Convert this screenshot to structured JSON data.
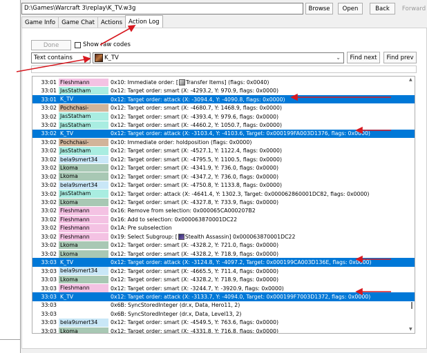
{
  "toolbar": {
    "path": "D:\\Games\\Warcraft 3\\replay\\K_TV.w3g",
    "browse_label": "Browse",
    "open_label": "Open",
    "back_label": "Back",
    "forward_label": "Forward"
  },
  "tabs": [
    {
      "label": "Game Info"
    },
    {
      "label": "Game Chat"
    },
    {
      "label": "Actions"
    },
    {
      "label": "Action Log"
    }
  ],
  "filter": {
    "done_label": "Done",
    "show_raw_label": "Show raw codes",
    "filter_type": "Text contains",
    "search_value": "K_TV",
    "find_next_label": "Find next",
    "find_prev_label": "Find prev"
  },
  "colors": {
    "Fleshmann": "#f4c2e3",
    "JasStatham": "#a9ede1",
    "K_TV": "#a9dbc8",
    "Pochchasi-": "#d2b49a",
    "bela9smert34": "#c9e7f7",
    "Lkoma": "#a8c8b4",
    "selected": "#0078d7",
    "arrow": "#d71920"
  },
  "log": [
    {
      "time": "33:01",
      "player": "Fleshmann",
      "pre": "0x10: Immediate order: [",
      "icon": "transfer",
      "post": "Transfer Items] (flags: 0x0040)",
      "selected": false
    },
    {
      "time": "33:01",
      "player": "JasStatham",
      "pre": "0x12: Target order: smart (X: -4293.2, Y: 970.9, flags: 0x0000)",
      "icon": "",
      "post": "",
      "selected": false
    },
    {
      "time": "33:01",
      "player": "K_TV",
      "pre": "0x12: Target order: attack (X: -3094.4, Y: -4090.8, flags: 0x0000)",
      "icon": "",
      "post": "",
      "selected": true
    },
    {
      "time": "33:02",
      "player": "Pochchasi-",
      "pre": "0x12: Target order: smart (X: -4680.7, Y: 1468.9, flags: 0x0000)",
      "icon": "",
      "post": "",
      "selected": false
    },
    {
      "time": "33:02",
      "player": "JasStatham",
      "pre": "0x12: Target order: smart (X: -4393.4, Y: 979.6, flags: 0x0000)",
      "icon": "",
      "post": "",
      "selected": false
    },
    {
      "time": "33:02",
      "player": "JasStatham",
      "pre": "0x12: Target order: smart (X: -4460.2, Y: 1050.7, flags: 0x0000)",
      "icon": "",
      "post": "",
      "selected": false
    },
    {
      "time": "33:02",
      "player": "K_TV",
      "pre": "0x12: Target order: attack (X: -3103.4, Y: -4103.6, Target: 0x000199FA003D1376, flags: 0x0000)",
      "icon": "",
      "post": "",
      "selected": true
    },
    {
      "time": "33:02",
      "player": "Pochchasi-",
      "pre": "0x10: Immediate order: holdposition (flags: 0x0000)",
      "icon": "",
      "post": "",
      "selected": false
    },
    {
      "time": "33:02",
      "player": "JasStatham",
      "pre": "0x12: Target order: smart (X: -4527.1, Y: 1122.4, flags: 0x0000)",
      "icon": "",
      "post": "",
      "selected": false
    },
    {
      "time": "33:02",
      "player": "bela9smert34",
      "pre": "0x12: Target order: smart (X: -4795.5, Y: 1100.5, flags: 0x0000)",
      "icon": "",
      "post": "",
      "selected": false
    },
    {
      "time": "33:02",
      "player": "Lkoma",
      "pre": "0x12: Target order: smart (X: -4341.9, Y: 736.0, flags: 0x0000)",
      "icon": "",
      "post": "",
      "selected": false
    },
    {
      "time": "33:02",
      "player": "Lkoma",
      "pre": "0x12: Target order: smart (X: -4347.2, Y: 736.0, flags: 0x0000)",
      "icon": "",
      "post": "",
      "selected": false
    },
    {
      "time": "33:02",
      "player": "bela9smert34",
      "pre": "0x12: Target order: smart (X: -4750.8, Y: 1133.8, flags: 0x0000)",
      "icon": "",
      "post": "",
      "selected": false
    },
    {
      "time": "33:02",
      "player": "JasStatham",
      "pre": "0x12: Target order: attack (X: -4641.4, Y: 1302.3, Target: 0x000062860001DC82, flags: 0x0000)",
      "icon": "",
      "post": "",
      "selected": false
    },
    {
      "time": "33:02",
      "player": "Lkoma",
      "pre": "0x12: Target order: smart (X: -4327.8, Y: 733.9, flags: 0x0000)",
      "icon": "",
      "post": "",
      "selected": false
    },
    {
      "time": "33:02",
      "player": "Fleshmann",
      "pre": "0x16: Remove from selection: 0x000065CA000207B2",
      "icon": "",
      "post": "",
      "selected": false
    },
    {
      "time": "33:02",
      "player": "Fleshmann",
      "pre": "0x16: Add to selection: 0x000063870001DC22",
      "icon": "",
      "post": "",
      "selected": false
    },
    {
      "time": "33:02",
      "player": "Fleshmann",
      "pre": "0x1A: Pre subselection",
      "icon": "",
      "post": "",
      "selected": false
    },
    {
      "time": "33:02",
      "player": "Fleshmann",
      "pre": "0x19: Select Subgroup: [",
      "icon": "stealth",
      "post": "Stealth Assassin] 0x000063870001DC22",
      "selected": false
    },
    {
      "time": "33:02",
      "player": "Lkoma",
      "pre": "0x12: Target order: smart (X: -4328.2, Y: 721.0, flags: 0x0000)",
      "icon": "",
      "post": "",
      "selected": false
    },
    {
      "time": "33:02",
      "player": "Lkoma",
      "pre": "0x12: Target order: smart (X: -4328.2, Y: 718.9, flags: 0x0000)",
      "icon": "",
      "post": "",
      "selected": false
    },
    {
      "time": "33:03",
      "player": "K_TV",
      "pre": "0x12: Target order: attack (X: -3124.8, Y: -4097.2, Target: 0x000199CA003D136E, flags: 0x0000)",
      "icon": "",
      "post": "",
      "selected": true
    },
    {
      "time": "33:03",
      "player": "bela9smert34",
      "pre": "0x12: Target order: smart (X: -4665.5, Y: 711.4, flags: 0x0000)",
      "icon": "",
      "post": "",
      "selected": false
    },
    {
      "time": "33:03",
      "player": "Lkoma",
      "pre": "0x12: Target order: smart (X: -4328.2, Y: 718.9, flags: 0x0000)",
      "icon": "",
      "post": "",
      "selected": false
    },
    {
      "time": "33:03",
      "player": "Fleshmann",
      "pre": "0x12: Target order: smart (X: -3244.7, Y: -3920.9, flags: 0x0000)",
      "icon": "",
      "post": "",
      "selected": false
    },
    {
      "time": "33:03",
      "player": "K_TV",
      "pre": "0x12: Target order: attack (X: -3133.7, Y: -4094.0, Target: 0x000199F7003D1372, flags: 0x0000)",
      "icon": "",
      "post": "",
      "selected": true
    },
    {
      "time": "33:03",
      "player": "",
      "pre": "0x6B: SyncStoredInteger (dr.x, Data, Hero11, 2)",
      "icon": "",
      "post": "",
      "selected": false
    },
    {
      "time": "33:03",
      "player": "",
      "pre": "0x6B: SyncStoredInteger (dr.x, Data, Level13, 2)",
      "icon": "",
      "post": "",
      "selected": false
    },
    {
      "time": "33:03",
      "player": "bela9smert34",
      "pre": "0x12: Target order: smart (X: -4549.5, Y: 763.6, flags: 0x0000)",
      "icon": "",
      "post": "",
      "selected": false
    },
    {
      "time": "33:03",
      "player": "Lkoma",
      "pre": "0x12: Target order: smart (X: -4331.8, Y: 716.8, flags: 0x0000)",
      "icon": "",
      "post": "",
      "selected": false
    }
  ]
}
